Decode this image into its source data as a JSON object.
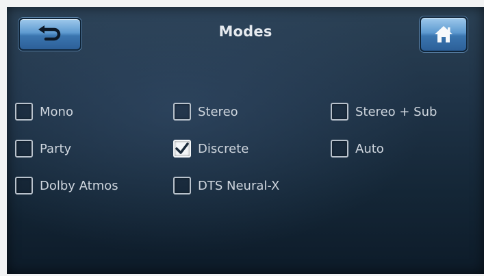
{
  "header": {
    "title": "Modes"
  },
  "icons": {
    "back": "back-arrow-icon",
    "home": "home-icon"
  },
  "colors": {
    "button_blue": "#5e9ad0",
    "background": "#1f3347",
    "label": "#cfd6de"
  },
  "options": [
    {
      "label": "Mono",
      "checked": false
    },
    {
      "label": "Stereo",
      "checked": false
    },
    {
      "label": "Stereo + Sub",
      "checked": false
    },
    {
      "label": "Party",
      "checked": false
    },
    {
      "label": "Discrete",
      "checked": true
    },
    {
      "label": "Auto",
      "checked": false
    },
    {
      "label": "Dolby Atmos",
      "checked": false
    },
    {
      "label": "DTS Neural-X",
      "checked": false
    }
  ]
}
